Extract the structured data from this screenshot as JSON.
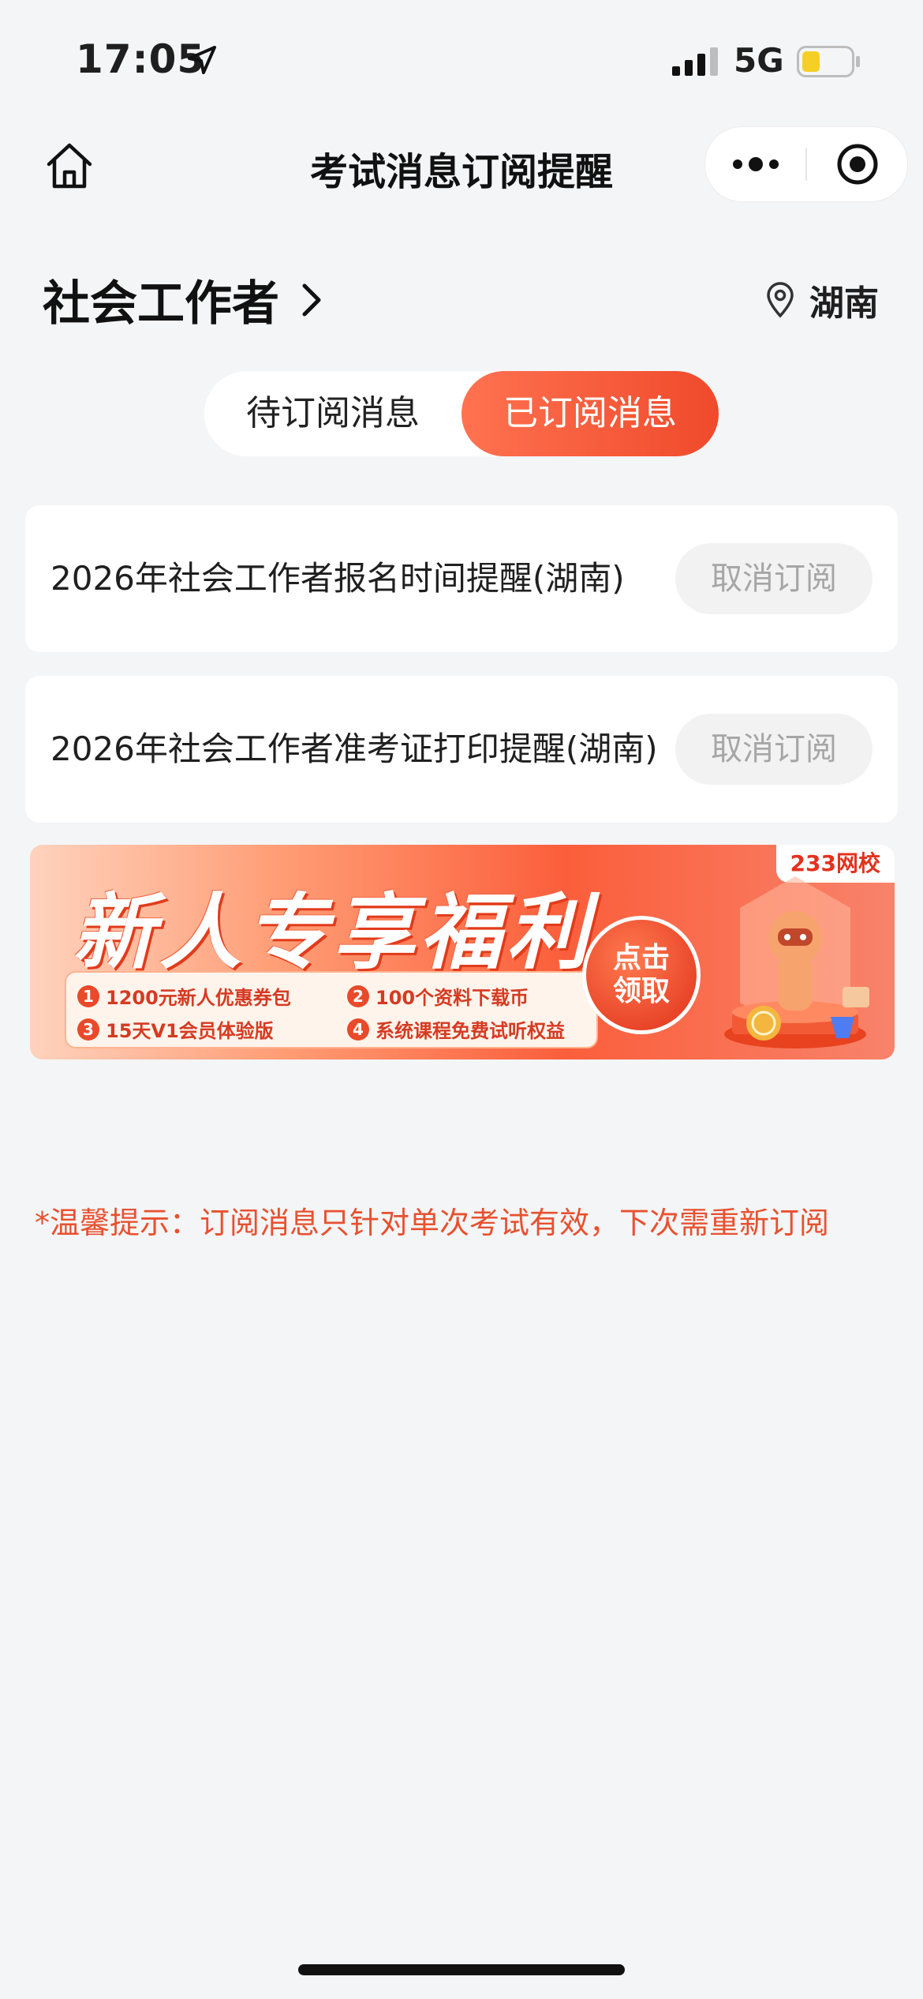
{
  "status_bar": {
    "time": "17:05",
    "network": "5G",
    "battery_percent": 30
  },
  "nav": {
    "title": "考试消息订阅提醒"
  },
  "header": {
    "category": "社会工作者",
    "region": "湖南"
  },
  "tabs": [
    {
      "label": "待订阅消息",
      "active": false
    },
    {
      "label": "已订阅消息",
      "active": true
    }
  ],
  "subscriptions": [
    {
      "title": "2026年社会工作者报名时间提醒(湖南)",
      "action": "取消订阅"
    },
    {
      "title": "2026年社会工作者准考证打印提醒(湖南)",
      "action": "取消订阅"
    }
  ],
  "banner": {
    "brand": "233网校",
    "headline": "新人专享福利",
    "perks": [
      {
        "num": "1",
        "text": "1200元新人优惠券包"
      },
      {
        "num": "2",
        "text": "100个资料下载币"
      },
      {
        "num": "3",
        "text": "15天V1会员体验版"
      },
      {
        "num": "4",
        "text": "系统课程免费试听权益"
      }
    ],
    "claim_line1": "点击",
    "claim_line2": "领取"
  },
  "hint": "*温馨提示：订阅消息只针对单次考试有效，下次需重新订阅",
  "colors": {
    "accent": "#ef4a2b",
    "hint": "#e8512f",
    "background": "#f4f5f7"
  }
}
